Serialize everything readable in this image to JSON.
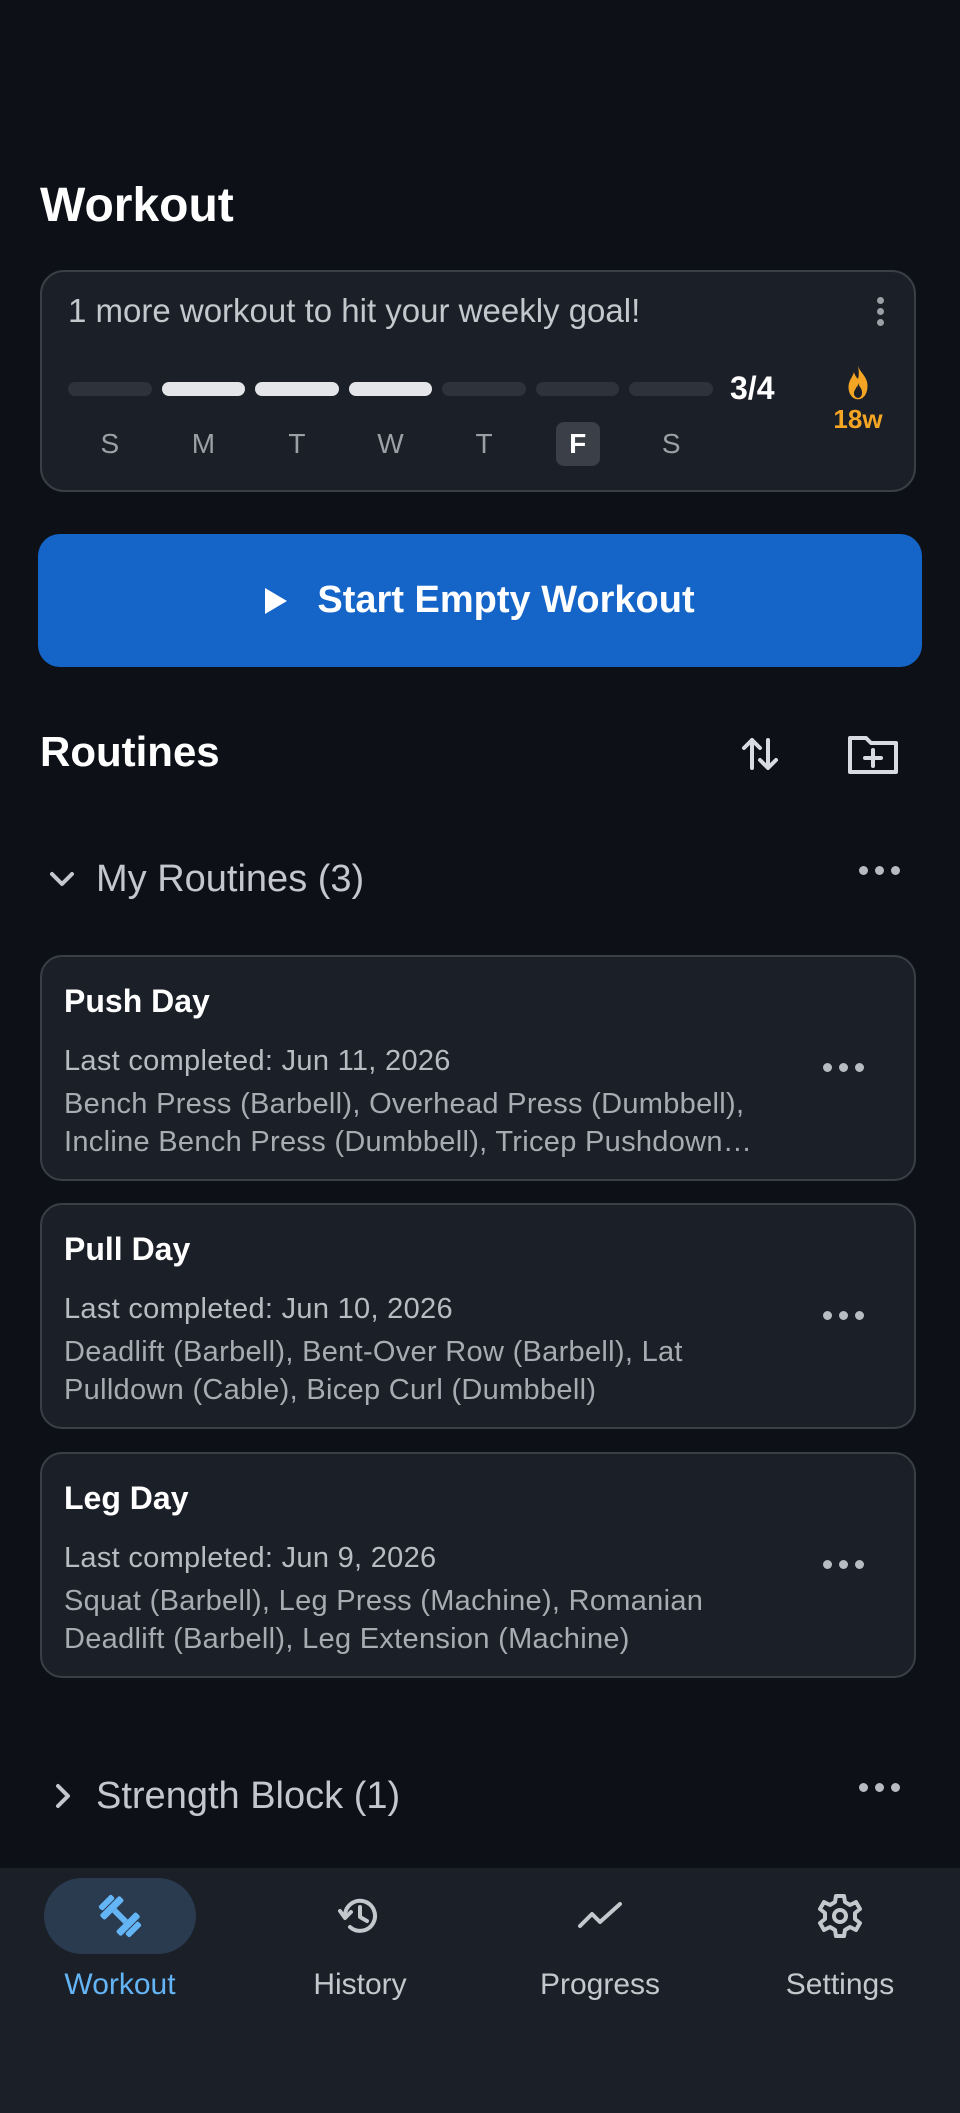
{
  "header": {
    "title": "Workout"
  },
  "weekly_goal": {
    "message": "1 more workout to hit your weekly goal!",
    "count": "3/4",
    "completed_fraction": 0.75,
    "days": [
      "S",
      "M",
      "T",
      "W",
      "T",
      "F",
      "S"
    ],
    "completed_days": [
      2,
      3,
      4
    ],
    "today_index": 5,
    "streak": "18w",
    "streak_color": "#f5a524"
  },
  "start_button": {
    "label": "Start Empty Workout",
    "color": "#1565c8"
  },
  "routines": {
    "title": "Routines",
    "folders": [
      {
        "name": "My Routines (3)",
        "expanded": true,
        "items": [
          {
            "name": "Push Day",
            "last_completed": "Last completed: Jun 11, 2026",
            "exercises": "Bench Press (Barbell), Overhead Press (Dumbbell), Incline Bench Press (Dumbbell), Tricep Pushdown (Cable)"
          },
          {
            "name": "Pull Day",
            "last_completed": "Last completed: Jun 10, 2026",
            "exercises": "Deadlift (Barbell), Bent-Over Row (Barbell), Lat Pulldown (Cable), Bicep Curl (Dumbbell)"
          },
          {
            "name": "Leg Day",
            "last_completed": "Last completed: Jun 9, 2026",
            "exercises": "Squat (Barbell), Leg Press (Machine), Romanian Deadlift (Barbell), Leg Extension (Machine)"
          }
        ]
      },
      {
        "name": "Strength Block (1)",
        "expanded": false
      }
    ]
  },
  "tabbar": {
    "active": "Workout",
    "accent": "#64b5f6",
    "tabs": [
      {
        "label": "Workout",
        "icon": "dumbbell-icon"
      },
      {
        "label": "History",
        "icon": "history-icon"
      },
      {
        "label": "Progress",
        "icon": "trend-icon"
      },
      {
        "label": "Settings",
        "icon": "gear-icon"
      }
    ]
  }
}
